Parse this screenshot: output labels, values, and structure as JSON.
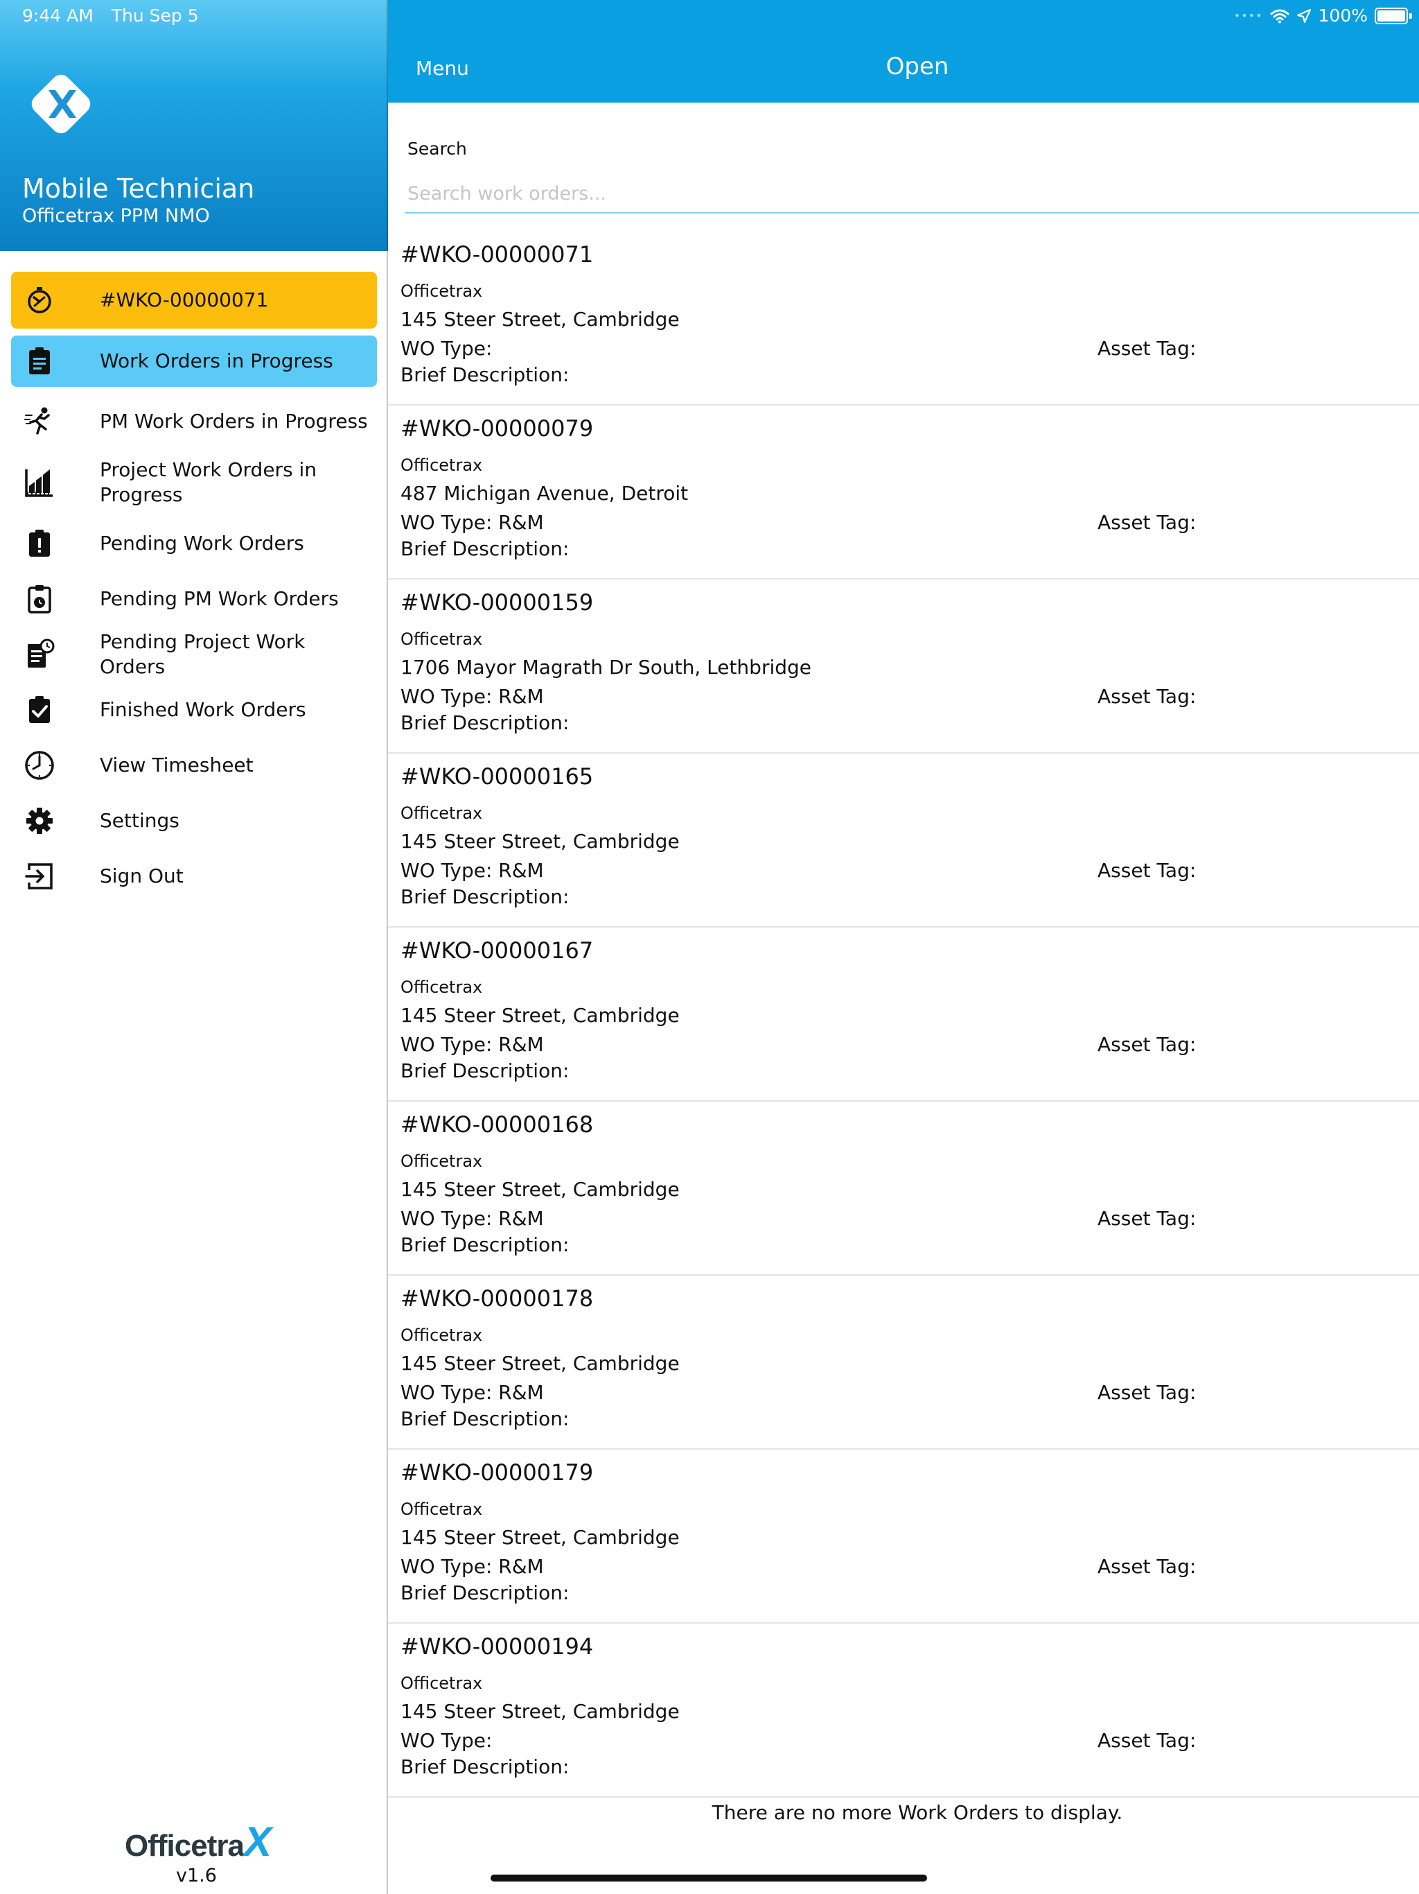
{
  "status_bar": {
    "time": "9:44 AM",
    "date": "Thu Sep 5",
    "battery": "100%"
  },
  "sidebar": {
    "app_title": "Mobile Technician",
    "app_subtitle": "Officetrax PPM NMO",
    "current_work_order": "#WKO-00000071",
    "items": [
      {
        "label": "Work Orders in Progress",
        "icon": "clipboard-icon"
      },
      {
        "label": "PM Work Orders in Progress",
        "icon": "runner-icon"
      },
      {
        "label": "Project Work Orders in Progress",
        "icon": "chart-ruler-icon"
      },
      {
        "label": "Pending Work Orders",
        "icon": "clipboard-alert-icon"
      },
      {
        "label": "Pending PM Work Orders",
        "icon": "clipboard-clock-icon"
      },
      {
        "label": "Pending Project Work Orders",
        "icon": "document-clock-icon"
      },
      {
        "label": "Finished Work Orders",
        "icon": "clipboard-check-icon"
      },
      {
        "label": "View Timesheet",
        "icon": "clock-icon"
      },
      {
        "label": "Settings",
        "icon": "gear-icon"
      },
      {
        "label": "Sign Out",
        "icon": "sign-out-icon"
      }
    ],
    "footer_brand": "Officetra",
    "footer_brand_x": "X",
    "version": "v1.6"
  },
  "topbar": {
    "menu_label": "Menu",
    "title": "Open"
  },
  "search": {
    "label": "Search",
    "placeholder": "Search work orders...",
    "value": ""
  },
  "work_orders": [
    {
      "number": "#WKO-00000071",
      "company": "Officetrax",
      "address": "145 Steer Street, Cambridge",
      "type": "WO Type:",
      "asset": "Asset Tag:",
      "description": "Brief Description:"
    },
    {
      "number": "#WKO-00000079",
      "company": "Officetrax",
      "address": "487 Michigan Avenue, Detroit",
      "type": "WO Type: R&M",
      "asset": "Asset Tag:",
      "description": "Brief Description:"
    },
    {
      "number": "#WKO-00000159",
      "company": "Officetrax",
      "address": "1706 Mayor Magrath Dr South, Lethbridge",
      "type": "WO Type: R&M",
      "asset": "Asset Tag:",
      "description": "Brief Description:"
    },
    {
      "number": "#WKO-00000165",
      "company": "Officetrax",
      "address": "145 Steer Street, Cambridge",
      "type": "WO Type: R&M",
      "asset": "Asset Tag:",
      "description": "Brief Description:"
    },
    {
      "number": "#WKO-00000167",
      "company": "Officetrax",
      "address": "145 Steer Street, Cambridge",
      "type": "WO Type: R&M",
      "asset": "Asset Tag:",
      "description": "Brief Description:"
    },
    {
      "number": "#WKO-00000168",
      "company": "Officetrax",
      "address": "145 Steer Street, Cambridge",
      "type": "WO Type: R&M",
      "asset": "Asset Tag:",
      "description": "Brief Description:"
    },
    {
      "number": "#WKO-00000178",
      "company": "Officetrax",
      "address": "145 Steer Street, Cambridge",
      "type": "WO Type: R&M",
      "asset": "Asset Tag:",
      "description": "Brief Description:"
    },
    {
      "number": "#WKO-00000179",
      "company": "Officetrax",
      "address": "145 Steer Street, Cambridge",
      "type": "WO Type: R&M",
      "asset": "Asset Tag:",
      "description": "Brief Description:"
    },
    {
      "number": "#WKO-00000194",
      "company": "Officetrax",
      "address": "145 Steer Street, Cambridge",
      "type": "WO Type:",
      "asset": "Asset Tag:",
      "description": "Brief Description:"
    }
  ],
  "end_message": "There are no more Work Orders to display.",
  "colors": {
    "header_blue": "#0a9fe0",
    "current_yellow": "#fdbd0d",
    "active_blue": "#5ccaf7",
    "brand_x": "#1aa3e6"
  }
}
